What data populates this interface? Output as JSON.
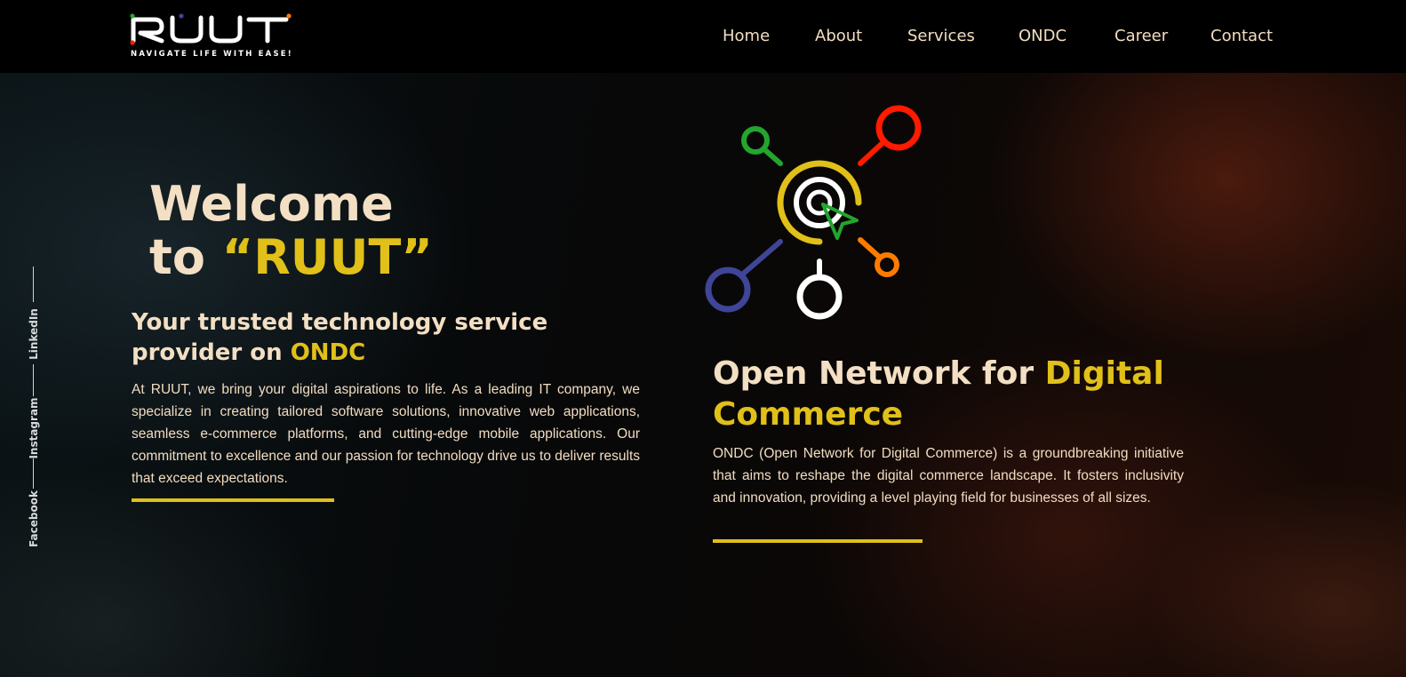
{
  "header": {
    "logo_text": "RUUT",
    "tagline": "NAVIGATE LIFE WITH EASE!",
    "nav": [
      {
        "label": "Home"
      },
      {
        "label": "About"
      },
      {
        "label": "Services"
      },
      {
        "label": "ONDC"
      },
      {
        "label": "Career"
      },
      {
        "label": "Contact"
      }
    ]
  },
  "social": {
    "links": [
      {
        "label": "LinkedIn",
        "icon": "linkedin-icon"
      },
      {
        "label": "Instagram",
        "icon": "instagram-icon"
      },
      {
        "label": "Facebook",
        "icon": "facebook-icon"
      }
    ]
  },
  "hero_left": {
    "welcome_line1": "Welcome",
    "welcome_to": "to ",
    "welcome_brand": "“RUUT”",
    "subtitle_part1": "Your trusted technology service provider on ",
    "subtitle_highlight": "ONDC",
    "description": "At RUUT, we bring your digital aspirations to life. As a leading IT company, we specialize in creating tailored software solutions, innovative web applications, seamless e-commerce platforms, and cutting-edge mobile applications. Our commitment to excellence and our passion for technology drive us to deliver results that exceed expectations."
  },
  "hero_right": {
    "illustration_icon": "network-target-icon",
    "title_part1": "Open Network for ",
    "title_highlight": "Digital Commerce",
    "description": "ONDC (Open Network for Digital Commerce) is a groundbreaking initiative that aims to reshape the digital commerce landscape. It fosters inclusivity and innovation, providing a level playing field for businesses of all sizes."
  },
  "colors": {
    "accent_yellow": "#e0c019",
    "cream_text": "#f3dfc3",
    "nav_text": "#f2ddc0",
    "header_bg": "#000000",
    "node_green": "#23a52e",
    "node_red": "#ff1a00",
    "node_blue": "#3f4597",
    "node_orange": "#ff7b00",
    "node_white": "#ffffff"
  }
}
